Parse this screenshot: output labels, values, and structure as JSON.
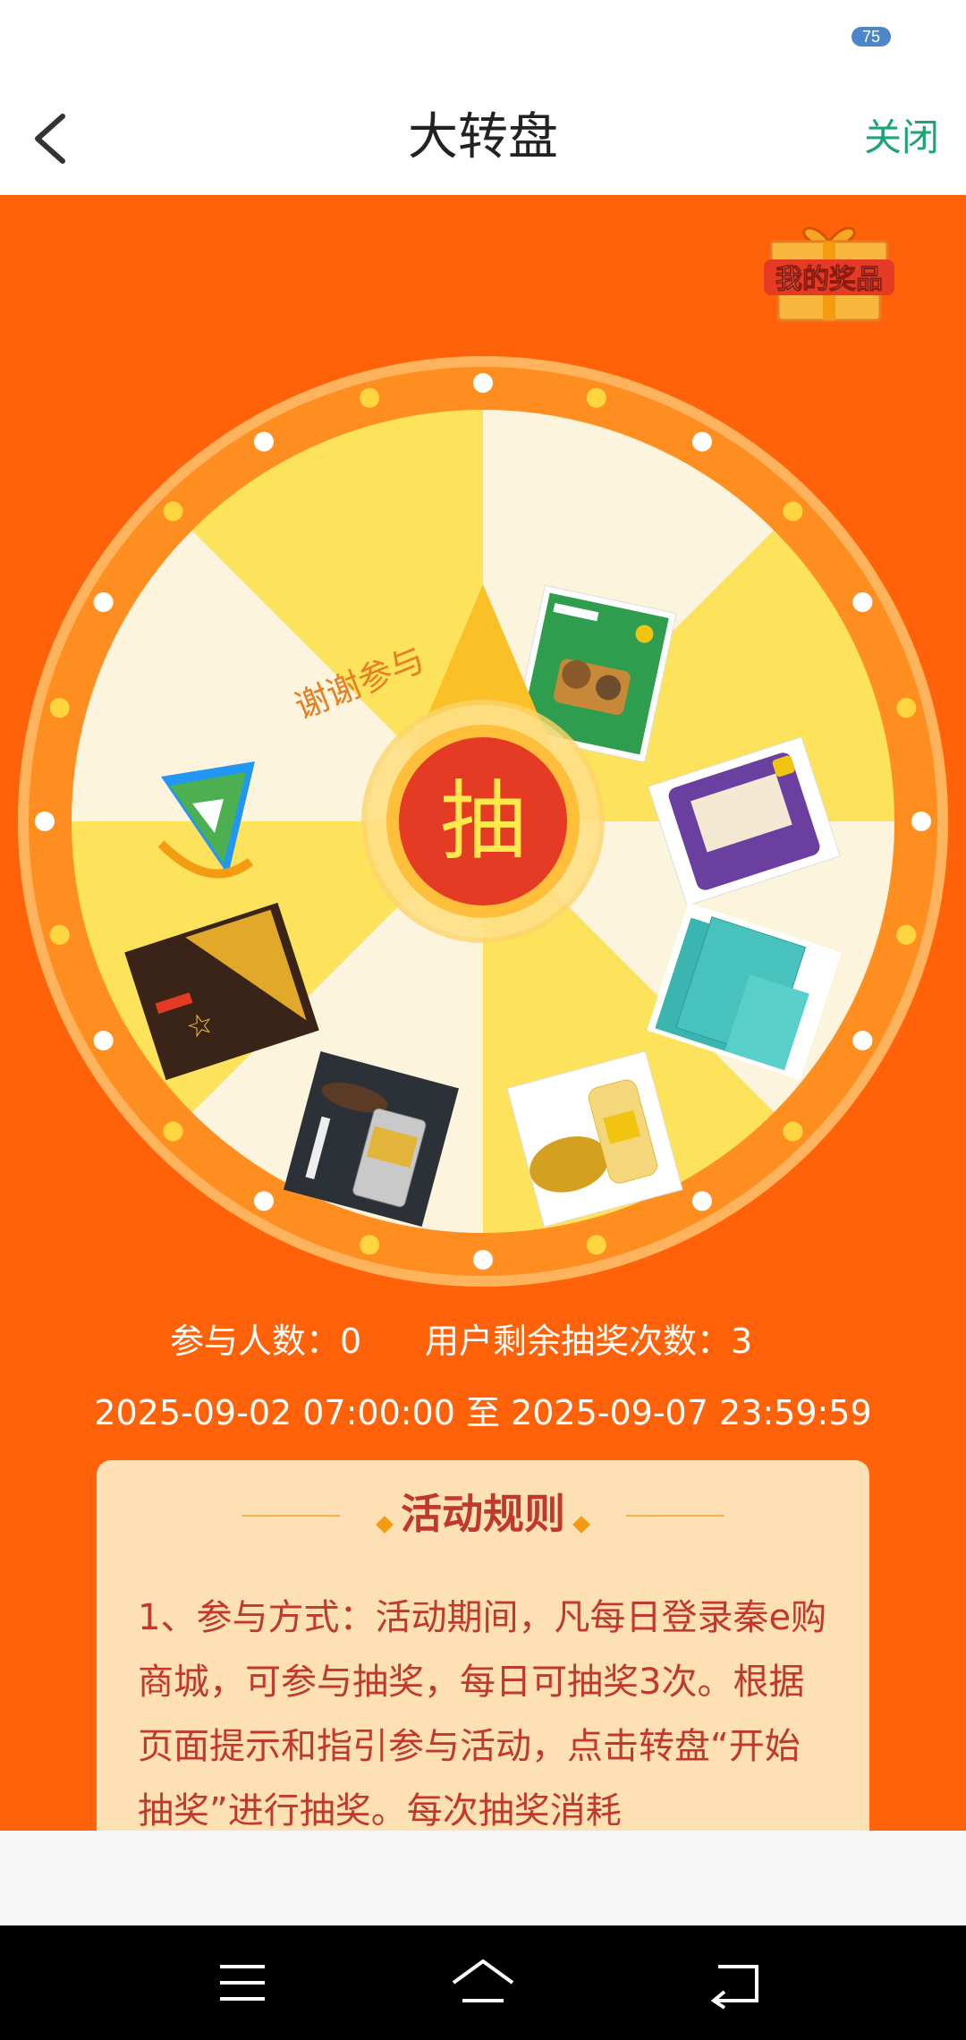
{
  "status_bar": {
    "battery": "75"
  },
  "nav": {
    "title": "大转盘",
    "close": "关闭"
  },
  "prize_button": {
    "label": "我的奖品"
  },
  "wheel": {
    "center_label": "抽",
    "thanks_label": "谢谢参与",
    "colors": {
      "light": "#fdf4de",
      "yellow": "#fde25c",
      "ring": "#ff8a1c",
      "center": "#e53b25"
    }
  },
  "stats": {
    "participants": "参与人数：0",
    "remaining": "用户剩余抽奖次数：3"
  },
  "date_range": "2025-09-02 07:00:00 至 2025-09-07 23:59:59",
  "rules": {
    "title": "活动规则",
    "text": "1、参与方式：活动期间，凡每日登录秦e购商城，可参与抽奖，每日可抽奖3次。根据页面提示和指引参与活动，点击转盘“开始抽奖”进行抽奖。每次抽奖消耗"
  }
}
